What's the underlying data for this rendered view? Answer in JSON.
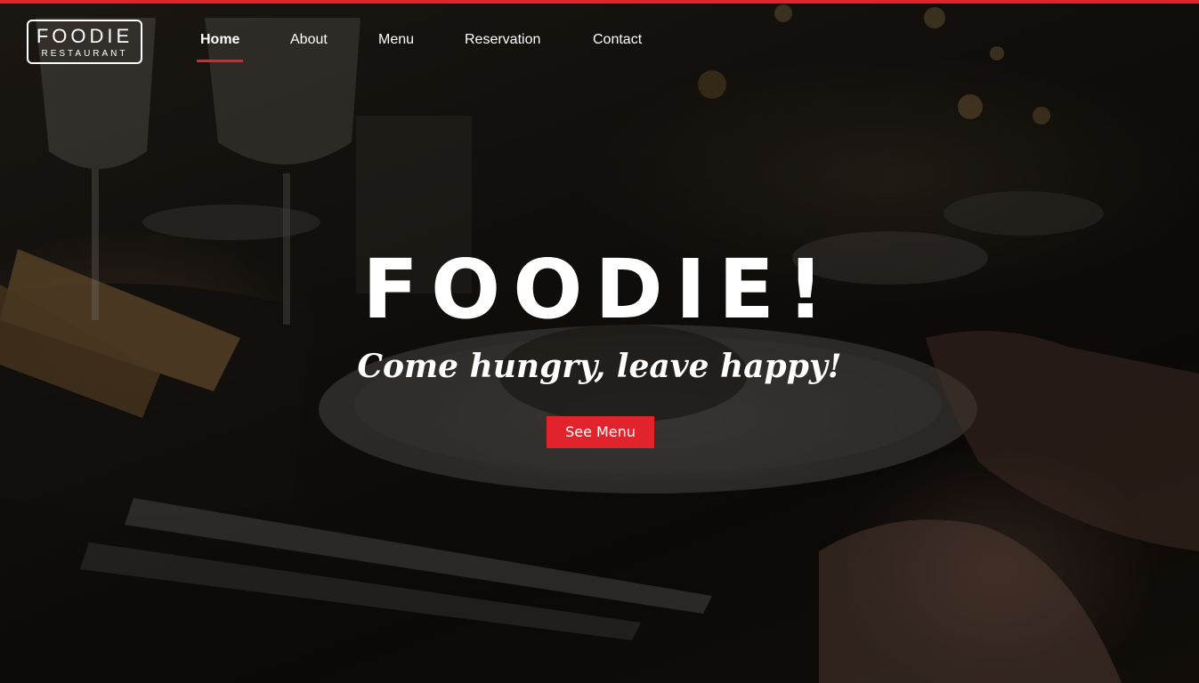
{
  "brand": {
    "name": "FOODIE",
    "subtitle": "RESTAURANT"
  },
  "nav": {
    "items": [
      {
        "label": "Home",
        "active": true
      },
      {
        "label": "About",
        "active": false
      },
      {
        "label": "Menu",
        "active": false
      },
      {
        "label": "Reservation",
        "active": false
      },
      {
        "label": "Contact",
        "active": false
      }
    ]
  },
  "hero": {
    "title": "FOODIE!",
    "tagline": "Come hungry, leave happy!",
    "cta_label": "See Menu"
  },
  "colors": {
    "accent": "#e3232b",
    "text": "#ffffff"
  }
}
